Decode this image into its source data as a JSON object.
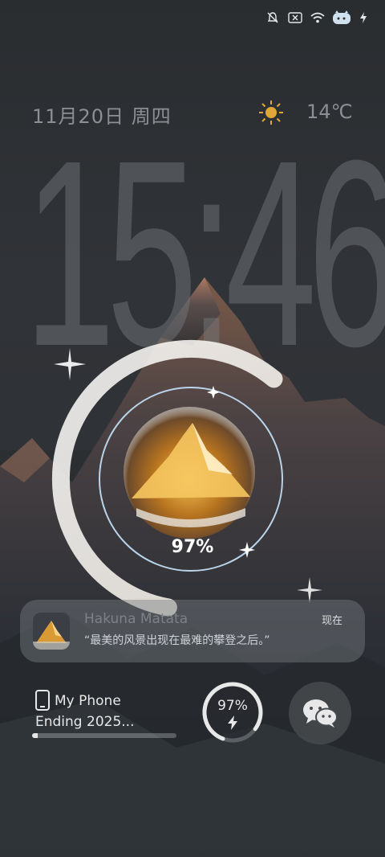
{
  "status_bar": {
    "icons": [
      "mute-bell-icon",
      "no-sim-icon",
      "wifi-icon",
      "battery-cartoon-icon",
      "charging-bolt-icon"
    ]
  },
  "lockscreen": {
    "date": "11月20日 周四",
    "weather_icon": "sun-icon",
    "temperature": "14℃",
    "time": "15:46"
  },
  "battery_widget": {
    "percent_label": "97%",
    "level": 0.97
  },
  "notification": {
    "title": "Hakuna Matata",
    "time": "现在",
    "body": "“最美的风景出现在最难的攀登之后。”"
  },
  "device_widget": {
    "name": "My Phone",
    "subtitle": "Ending 2025...",
    "progress": 0.04,
    "battery_label": "97%",
    "battery_level": 0.97
  },
  "app_shortcut": {
    "icon": "wechat-icon"
  },
  "colors": {
    "accent_light": "#e8e4dc",
    "ring_blue": "#b9d4ea",
    "mountain_gold": "#e0a23a"
  }
}
